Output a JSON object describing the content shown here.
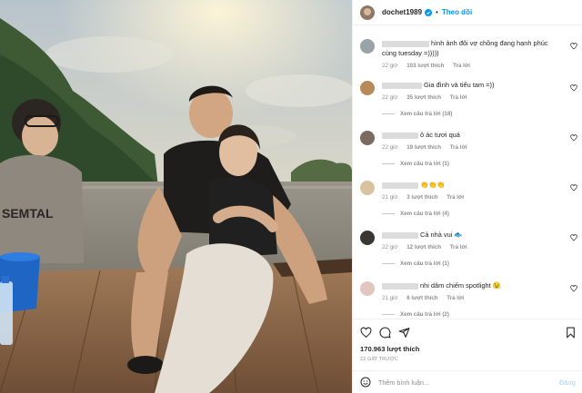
{
  "post": {
    "username": "dochet1989",
    "follow_label": "Theo dõi",
    "separator": "•",
    "likes_text": "170.963 lượt thích",
    "time_text": "22 GIỜ TRƯỚC",
    "comment_placeholder": "Thêm bình luận...",
    "post_label": "Đăng"
  },
  "comments": [
    {
      "text": "hình ảnh đôi vợ chồng đang hạnh phúc cùng tuesday =)))))",
      "time": "22 giờ",
      "likes": "103 lượt thích",
      "reply": "Trả lời",
      "view_replies": ""
    },
    {
      "text": "Gia đình và tiểu tam =))",
      "time": "22 giờ",
      "likes": "35 lượt thích",
      "reply": "Trả lời",
      "view_replies": "Xem câu trả lời (18)"
    },
    {
      "text": "ô ác tươi quá",
      "time": "22 giờ",
      "likes": "19 lượt thích",
      "reply": "Trả lời",
      "view_replies": "Xem câu trả lời (1)"
    },
    {
      "text": "👏👏👏",
      "time": "21 giờ",
      "likes": "3 lượt thích",
      "reply": "Trả lời",
      "view_replies": "Xem câu trả lời (4)"
    },
    {
      "text": "Cả nhà vui 🐟",
      "time": "22 giờ",
      "likes": "12 lượt thích",
      "reply": "Trả lời",
      "view_replies": "Xem câu trả lời (1)"
    },
    {
      "text": "nhi dâm chiếm spotlight 😉",
      "time": "21 giờ",
      "likes": "6 lượt thích",
      "reply": "Trả lời",
      "view_replies": "Xem câu trả lời (2)"
    }
  ],
  "photo": {
    "shirt_text": "SEMTAL"
  },
  "colors": {
    "link_blue": "#0095f6",
    "muted": "#8e8e8e",
    "text": "#262626",
    "border": "#efefef"
  },
  "icons": [
    "verified-badge-icon",
    "heart-icon",
    "comment-icon",
    "share-icon",
    "bookmark-icon",
    "emoji-icon"
  ]
}
